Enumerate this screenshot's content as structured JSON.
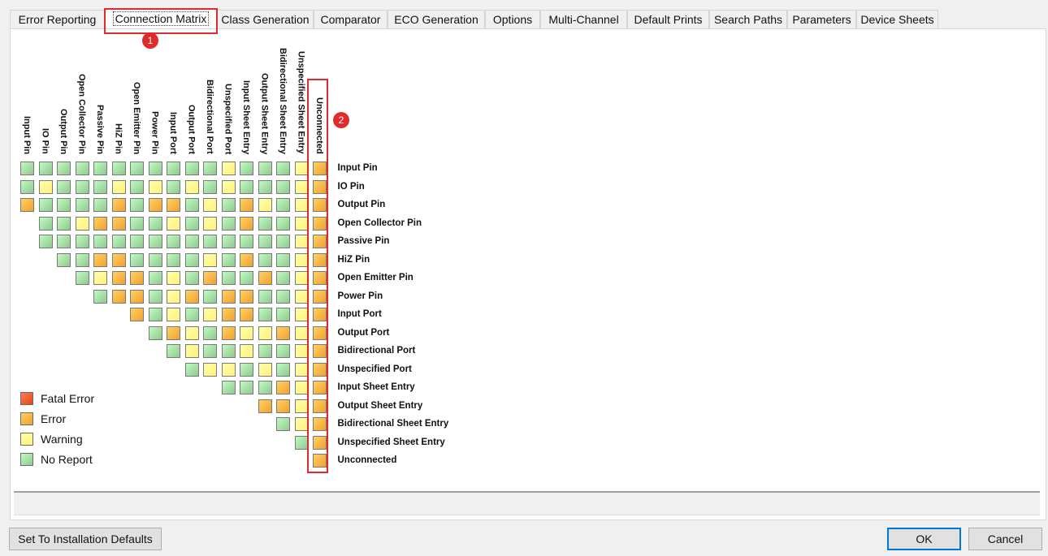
{
  "tabs": [
    {
      "label": "Error Reporting",
      "active": false
    },
    {
      "label": "Connection Matrix",
      "active": true
    },
    {
      "label": "Class Generation",
      "active": false
    },
    {
      "label": "Comparator",
      "active": false
    },
    {
      "label": "ECO Generation",
      "active": false
    },
    {
      "label": "Options",
      "active": false
    },
    {
      "label": "Multi-Channel",
      "active": false
    },
    {
      "label": "Default Prints",
      "active": false
    },
    {
      "label": "Search Paths",
      "active": false
    },
    {
      "label": "Parameters",
      "active": false
    },
    {
      "label": "Device Sheets",
      "active": false
    }
  ],
  "matrix": {
    "pin_types": [
      "Input Pin",
      "IO Pin",
      "Output Pin",
      "Open Collector Pin",
      "Passive Pin",
      "HiZ Pin",
      "Open Emitter Pin",
      "Power Pin",
      "Input Port",
      "Output Port",
      "Bidirectional Port",
      "Unspecified Port",
      "Input Sheet Entry",
      "Output Sheet Entry",
      "Bidirectional Sheet Entry",
      "Unspecified Sheet Entry",
      "Unconnected"
    ],
    "level_codes": {
      "F": "fatal",
      "E": "error",
      "W": "warning",
      "N": "no-report"
    },
    "rows": [
      "NNNNNNNNNNNWNNNWE",
      "NWNNNWNWNWNWNNNWE",
      "ENNNNENEENWNEWNWE",
      "NNWEENNWNWNENNWE",
      "NNNNNNNNNNNNNNWE",
      "NNEENNNNWNENNWE",
      "NWEENWNENNENWE",
      "NEENWENEENNWE",
      "ENWNWEENNWE",
      "NEWNEWWEWE",
      "NWNNWNNWE",
      "NWWNWNWE",
      "NNNEWE",
      "EEWE",
      "NWE",
      "NE",
      "E"
    ]
  },
  "legend": [
    {
      "label": "Fatal Error",
      "color": "#e04a1f"
    },
    {
      "label": "Error",
      "color": "#f0a030"
    },
    {
      "label": "Warning",
      "color": "#fff27a"
    },
    {
      "label": "No Report",
      "color": "#8fc98f"
    }
  ],
  "colors": {
    "fatal": "#e04a1f",
    "error": "#f0a030",
    "warning": "#fff27a",
    "no-report": "#8fc98f"
  },
  "annotations": [
    {
      "label": "1"
    },
    {
      "label": "2"
    }
  ],
  "buttons": {
    "defaults": "Set To Installation Defaults",
    "ok": "OK",
    "cancel": "Cancel"
  }
}
